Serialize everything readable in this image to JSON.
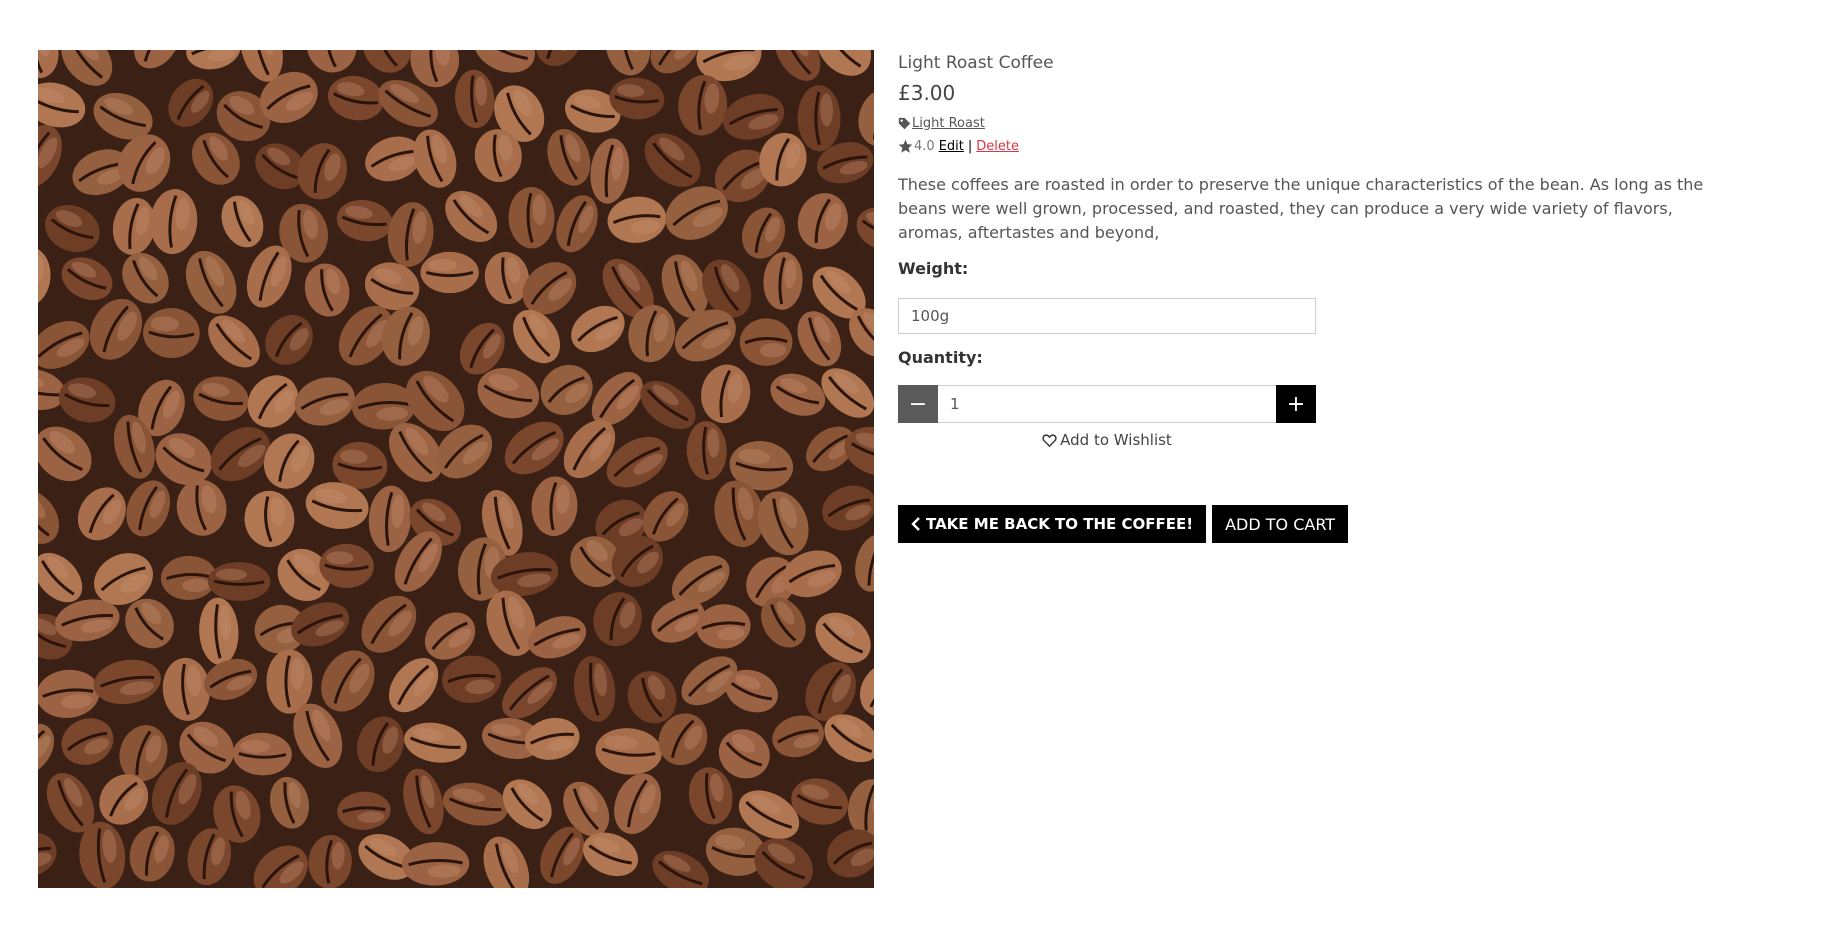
{
  "product": {
    "name": "Light Roast Coffee",
    "price": "£3.00",
    "category": "Light Roast",
    "rating": "4.0",
    "edit_label": "Edit",
    "separator": "|",
    "delete_label": "Delete",
    "description": "These coffees are roasted in order to preserve the unique characteristics of the bean. As long as the beans were well grown, processed, and roasted, they can produce a very wide variety of flavors, aromas, aftertastes and beyond,"
  },
  "form": {
    "weight_label": "Weight:",
    "weight_value": "100g",
    "quantity_label": "Quantity:",
    "quantity_value": "1",
    "minus_symbol": "−",
    "plus_symbol": "+",
    "wishlist_label": "Add to Wishlist"
  },
  "actions": {
    "back_label": "TAKE ME BACK TO THE COFFEE!",
    "cart_label": "ADD TO CART"
  },
  "icons": {
    "tag": "tag-icon",
    "star": "star-icon",
    "heart": "heart-outline-icon",
    "chevron": "chevron-left-icon"
  },
  "colors": {
    "delete": "#dc3545",
    "button": "#000000",
    "minus_button": "#5a5a5a"
  }
}
